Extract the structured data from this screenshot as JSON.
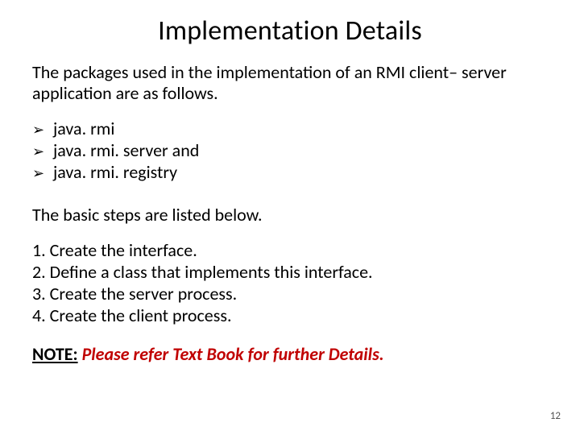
{
  "title": "Implementation Details",
  "intro": "The packages used in the implementation of an RMI client– server application are as follows.",
  "bullets": [
    "java. rmi",
    "java. rmi. server and",
    "java. rmi. registry"
  ],
  "arrow_glyph": "➢",
  "steps_intro": "The basic steps are listed below.",
  "steps": [
    "1. Create the interface.",
    "2. Define a class that implements this interface.",
    "3. Create the server process.",
    "4. Create the client process."
  ],
  "note": {
    "label": "NOTE:",
    "text": " Please refer Text Book for further Details."
  },
  "page_number": "12"
}
